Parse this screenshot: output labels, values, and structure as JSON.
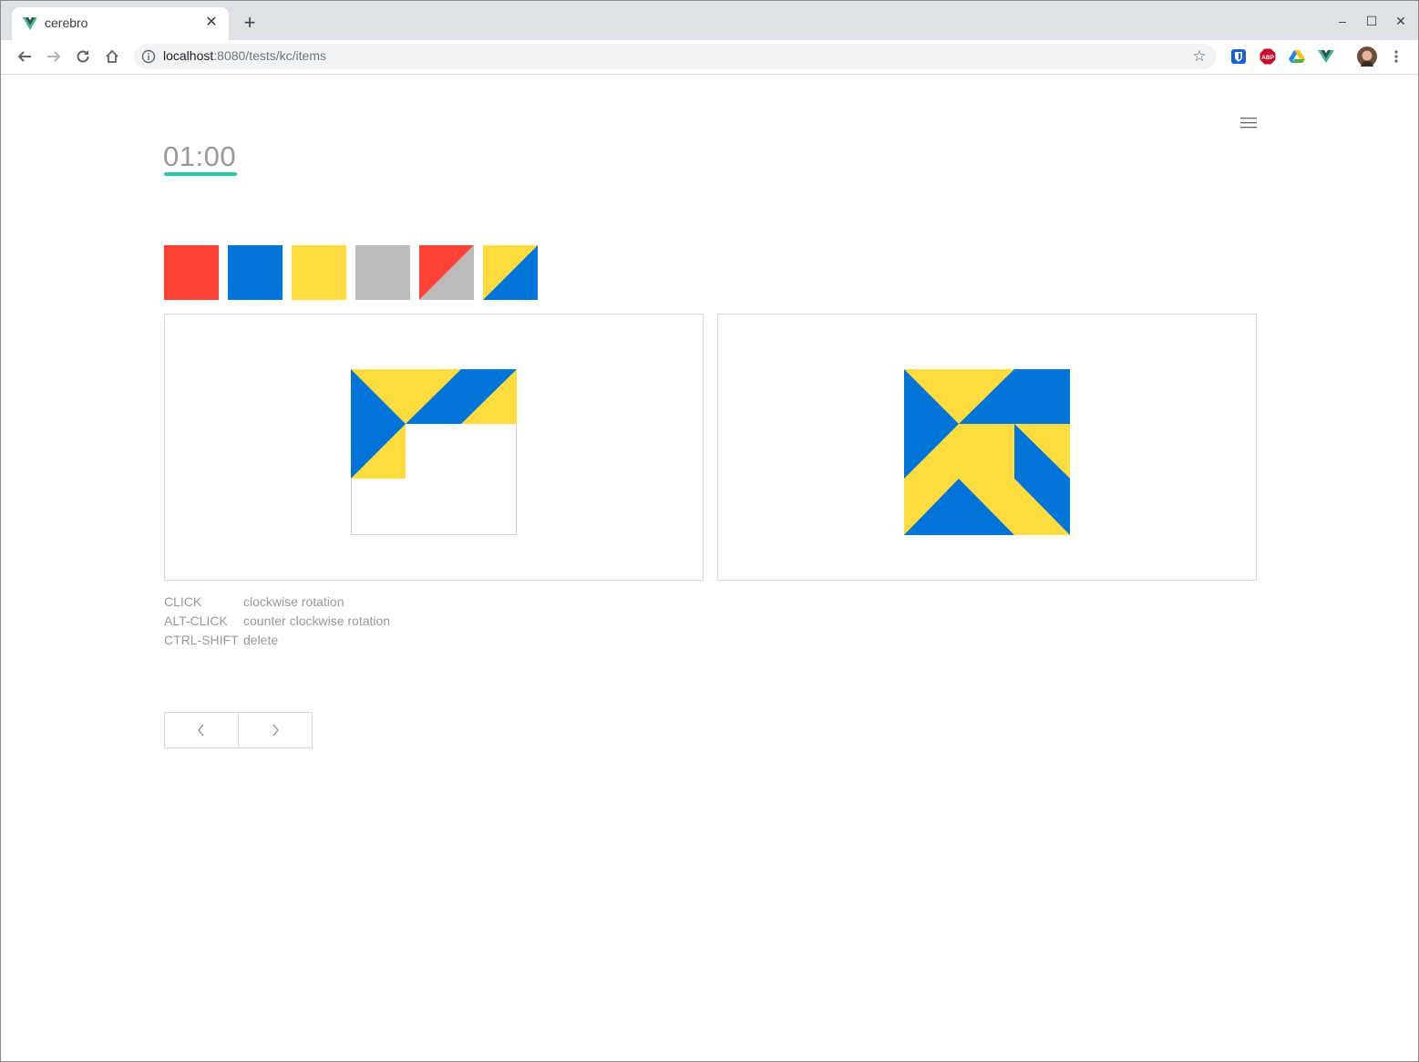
{
  "browser": {
    "tab_title": "cerebro",
    "tab_close": "✕",
    "new_tab": "+",
    "url_host": "localhost",
    "url_rest": ":8080/tests/kc/items",
    "window_controls": [
      "–",
      "☐",
      "✕"
    ],
    "extensions": [
      "bitwarden-icon",
      "adblock-plus-icon",
      "google-drive-icon",
      "vue-devtools-icon"
    ],
    "abp_label": "ABP"
  },
  "page": {
    "timer": "01:00",
    "accent_color": "#26c6a0",
    "swatches": [
      {
        "name": "red",
        "colors": [
          "#ff4136"
        ]
      },
      {
        "name": "blue",
        "colors": [
          "#0074d9"
        ]
      },
      {
        "name": "yellow",
        "colors": [
          "#ffdc3d"
        ]
      },
      {
        "name": "gray",
        "colors": [
          "#bbbbbb"
        ]
      },
      {
        "name": "red-gray-diagonal",
        "colors": [
          "#ff4136",
          "#bbbbbb"
        ]
      },
      {
        "name": "yellow-blue-diagonal",
        "colors": [
          "#ffdc3d",
          "#0074d9"
        ]
      }
    ],
    "legend": [
      {
        "key": "CLICK",
        "action": "clockwise rotation"
      },
      {
        "key": "ALT-CLICK",
        "action": "counter clockwise rotation"
      },
      {
        "key": "CTRL-SHIFT",
        "action": "delete"
      }
    ],
    "pager": {
      "prev": "‹",
      "next": "›"
    }
  }
}
